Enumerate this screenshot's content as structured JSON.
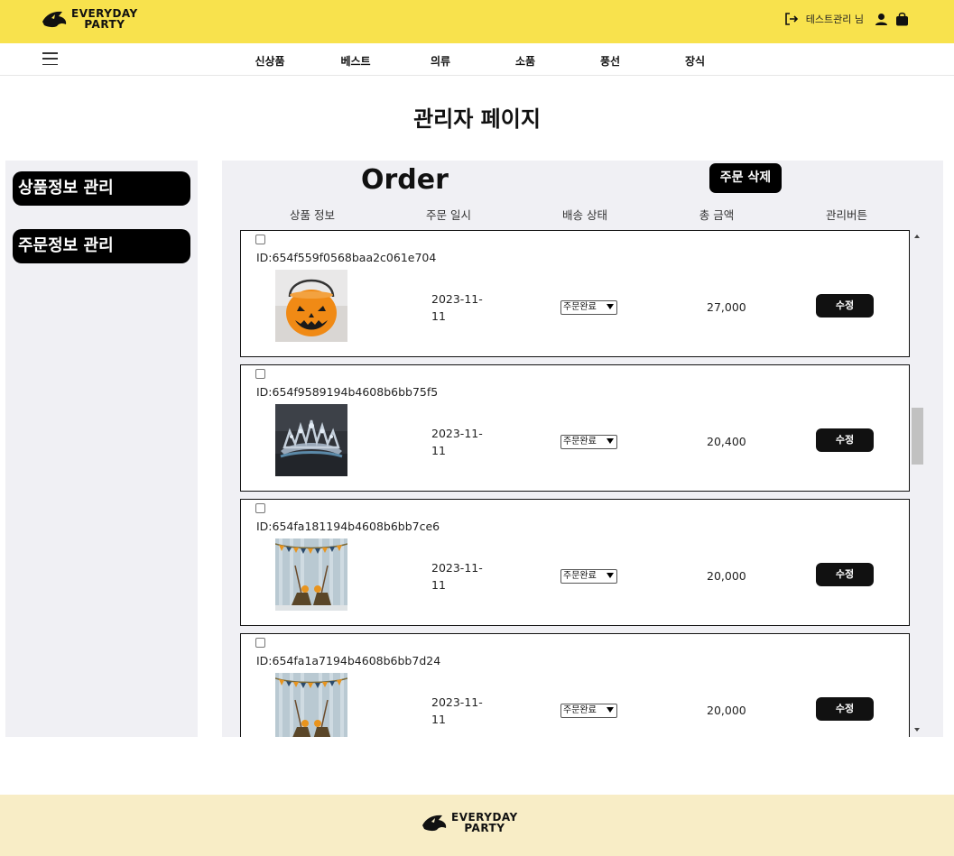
{
  "header": {
    "logo_line1": "EVERYDAY",
    "logo_line2": "PARTY",
    "user_label": "테스트관리 님",
    "logout_icon": "logout-icon",
    "user_icon": "user-icon",
    "cart_icon": "shopping-bag-icon",
    "background": "#f8e24d"
  },
  "nav": {
    "menu_icon": "hamburger-menu-icon",
    "items": [
      "신상품",
      "베스트",
      "의류",
      "소품",
      "풍선",
      "장식"
    ]
  },
  "page_title": "관리자 페이지",
  "sidebar": {
    "items": [
      "상품정보 관리",
      "주문정보 관리"
    ]
  },
  "orders": {
    "title": "Order",
    "delete_label": "주문 삭제",
    "columns": [
      "상품 정보",
      "주문 일시",
      "배송 상태",
      "총 금액",
      "관리버튼"
    ],
    "rows": [
      {
        "id": "ID:654f559f0568baa2c061e704",
        "date_line1": "2023-11-",
        "date_line2": "11",
        "status": "주문완료",
        "amount": "27,000",
        "edit_label": "수정",
        "image": "pumpkin-bucket"
      },
      {
        "id": "ID:654f9589194b4608b6bb75f5",
        "date_line1": "2023-11-",
        "date_line2": "11",
        "status": "주문완료",
        "amount": "20,400",
        "edit_label": "수정",
        "image": "tiara"
      },
      {
        "id": "ID:654fa181194b4608b6bb7ce6",
        "date_line1": "2023-11-",
        "date_line2": "11",
        "status": "주문완료",
        "amount": "20,000",
        "edit_label": "수정",
        "image": "witch-broom-garland"
      },
      {
        "id": "ID:654fa1a7194b4608b6bb7d24",
        "date_line1": "2023-11-",
        "date_line2": "11",
        "status": "주문완료",
        "amount": "20,000",
        "edit_label": "수정",
        "image": "witch-broom-garland"
      }
    ]
  },
  "footer": {
    "logo_line1": "EVERYDAY",
    "logo_line2": "PARTY",
    "background": "#f8edc6"
  }
}
